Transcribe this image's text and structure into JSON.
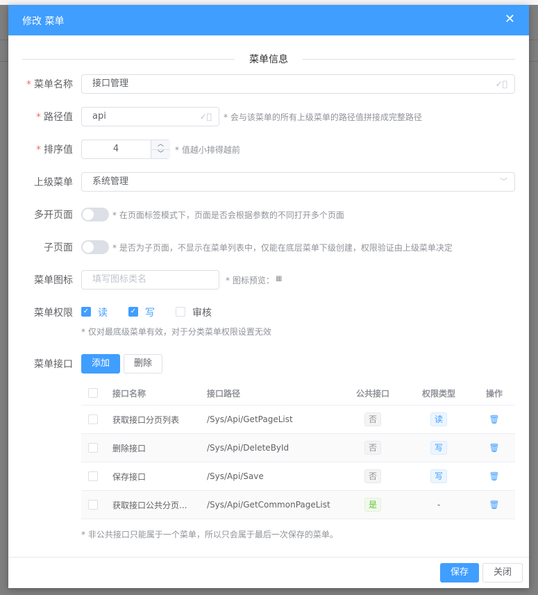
{
  "dialog": {
    "title": "修改 菜单",
    "close_icon": "close-icon"
  },
  "section_title": "菜单信息",
  "form": {
    "name": {
      "label": "菜单名称",
      "value": "接口管理",
      "required": true
    },
    "path": {
      "label": "路径值",
      "value": "api",
      "required": true,
      "hint": "* 会与该菜单的所有上级菜单的路径值拼接成完整路径"
    },
    "sort": {
      "label": "排序值",
      "value": "4",
      "required": true,
      "hint": "* 值越小排得越前"
    },
    "parent": {
      "label": "上级菜单",
      "value": "系统管理"
    },
    "multi_page": {
      "label": "多开页面",
      "on": false,
      "hint": "* 在页面标签模式下，页面是否会根据参数的不同打开多个页面"
    },
    "sub_page": {
      "label": "子页面",
      "on": false,
      "hint": "* 是否为子页面，不显示在菜单列表中，仅能在底层菜单下级创建，权限验证由上级菜单决定"
    },
    "icon": {
      "label": "菜单图标",
      "placeholder": "填写图标类名",
      "hint": "* 图标预览："
    },
    "permissions": {
      "label": "菜单权限",
      "options": [
        {
          "label": "读",
          "checked": true
        },
        {
          "label": "写",
          "checked": true
        },
        {
          "label": "审核",
          "checked": false
        }
      ],
      "hint": "* 仅对最底级菜单有效，对于分类菜单权限设置无效"
    },
    "apis": {
      "label": "菜单接口",
      "add_label": "添加",
      "delete_label": "删除",
      "columns": [
        "接口名称",
        "接口路径",
        "公共接口",
        "权限类型",
        "操作"
      ],
      "rows": [
        {
          "name": "获取接口分页列表",
          "path": "/Sys/Api/GetPageList",
          "public": "否",
          "perm": "读"
        },
        {
          "name": "删除接口",
          "path": "/Sys/Api/DeleteById",
          "public": "否",
          "perm": "写"
        },
        {
          "name": "保存接口",
          "path": "/Sys/Api/Save",
          "public": "否",
          "perm": "写"
        },
        {
          "name": "获取接口公共分页...",
          "path": "/Sys/Api/GetCommonPageList",
          "public": "是",
          "perm": "-"
        }
      ],
      "note": "* 非公共接口只能属于一个菜单，所以只会属于最后一次保存的菜单。"
    }
  },
  "footer": {
    "save_label": "保存",
    "close_label": "关闭"
  },
  "colors": {
    "primary": "#409eff",
    "danger": "#f56c6c",
    "success": "#67c23a"
  }
}
